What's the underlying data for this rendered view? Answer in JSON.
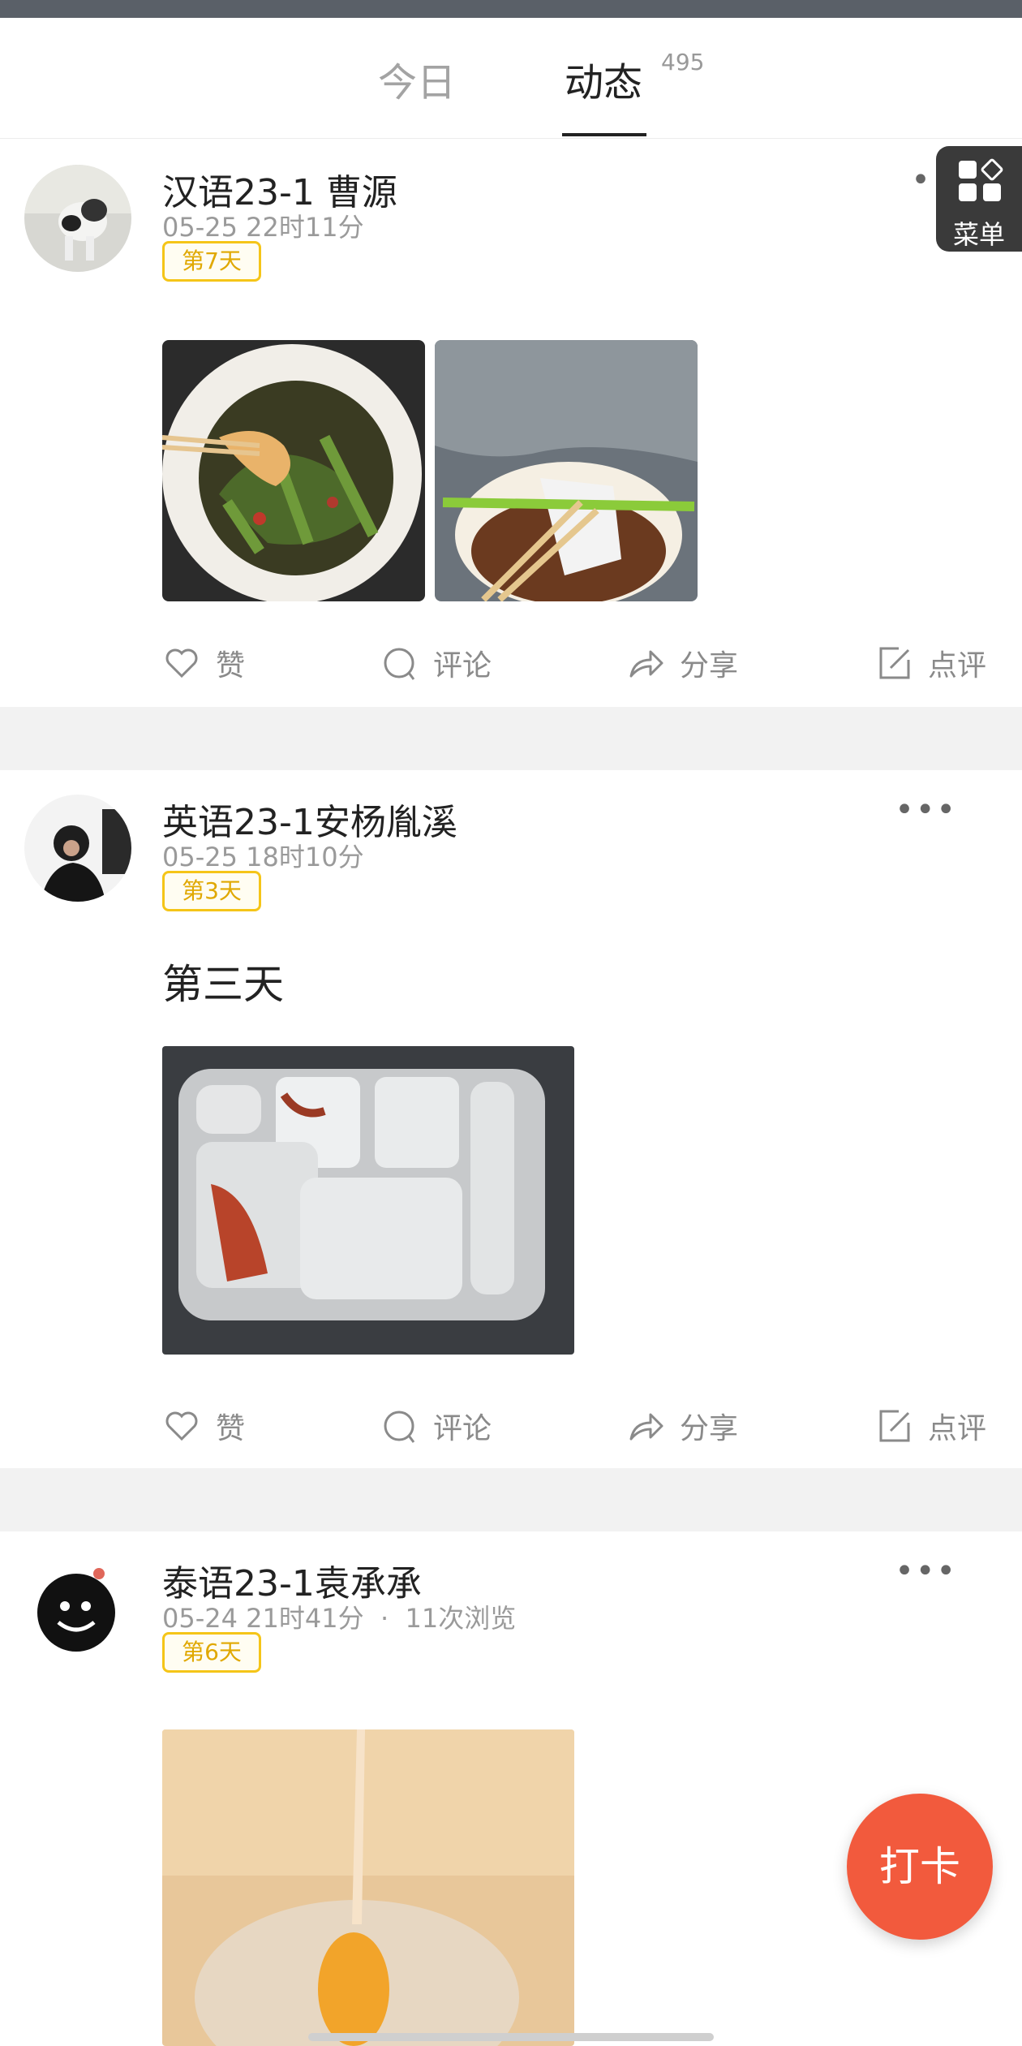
{
  "tabs": {
    "today": "今日",
    "feed": "动态",
    "feed_count": "495"
  },
  "menu": {
    "label": "菜单"
  },
  "fab": {
    "label": "打卡"
  },
  "actions": {
    "like": "赞",
    "comment": "评论",
    "share": "分享",
    "review": "点评"
  },
  "posts": [
    {
      "author": "汉语23-1 曹源",
      "time": "05-25 22时11分",
      "badge": "第7天",
      "text": "",
      "photos": 2
    },
    {
      "author": "英语23-1安杨胤溪",
      "time": "05-25 18时10分",
      "badge": "第3天",
      "text": "第三天",
      "photos": 1
    },
    {
      "author": "泰语23-1袁承承",
      "time": "05-24 21时41分",
      "views": "11次浏览",
      "badge": "第6天",
      "text": "",
      "photos": 1
    }
  ],
  "colors": {
    "accent": "#f5c518",
    "fab": "#f25a3d",
    "menu_bg": "#3a3a3a"
  }
}
